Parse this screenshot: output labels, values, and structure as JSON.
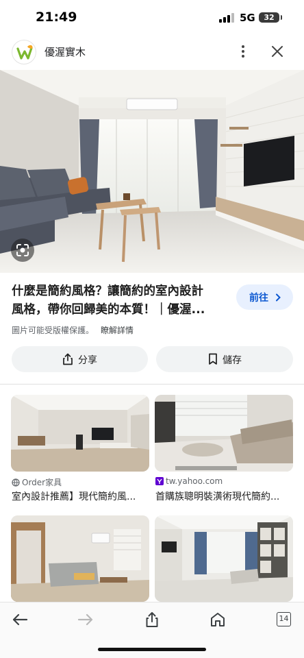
{
  "status_bar": {
    "time": "21:49",
    "network": "5G",
    "battery": "32"
  },
  "header": {
    "site_name": "優渥實木",
    "logo_icon": "w-leaf-logo-icon"
  },
  "result": {
    "title_line1": "什麼是簡約風格？讓簡約的室內設計",
    "title_line2": "風格，帶你回歸美的本質！｜優渥...",
    "visit_label": "前往",
    "copyright_notice": "圖片可能受版權保護。",
    "learn_more": "瞭解詳情",
    "share_label": "分享",
    "save_label": "儲存"
  },
  "related": [
    {
      "source": "Order家具",
      "source_icon": "globe-icon",
      "title": "室內設計推薦】現代簡約風..."
    },
    {
      "source": "tw.yahoo.com",
      "source_icon": "yahoo-icon",
      "title": "首購族聰明裝潢術現代簡約..."
    },
    {
      "source": "",
      "title": ""
    },
    {
      "source": "",
      "title": ""
    }
  ],
  "bottom_bar": {
    "tab_count": "14"
  },
  "colors": {
    "accent": "#0b57d0",
    "visit_bg": "#e8f0fe",
    "chip_bg": "#f1f3f4",
    "logo_green": "#7cb82f",
    "logo_orange": "#f5a623"
  }
}
